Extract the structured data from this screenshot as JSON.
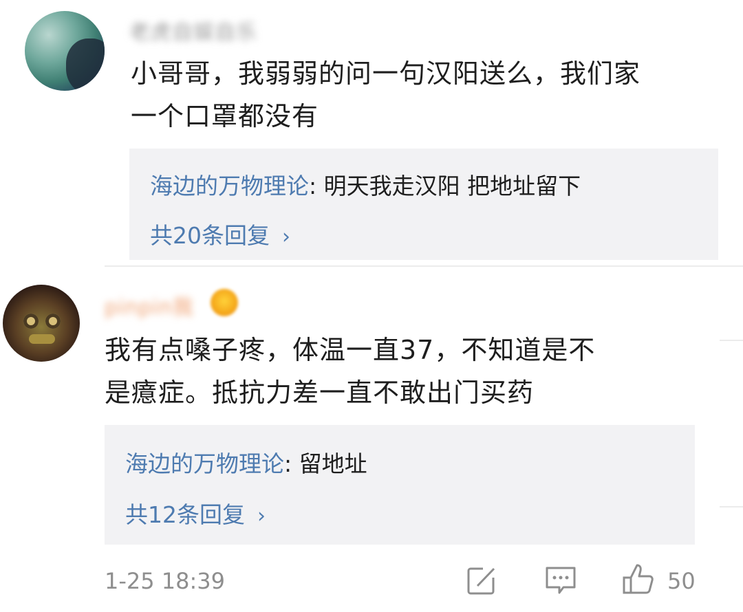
{
  "comments": [
    {
      "username": "老虎自娱自乐",
      "text": "小哥哥，我弱弱的问一句汉阳送么，我们家\n一个口罩都没有",
      "reply": {
        "author": "海边的万物理论",
        "separator": ": ",
        "text": "明天我走汉阳 把地址留下",
        "count_label": "共20条回复"
      }
    },
    {
      "username": "pinpin我",
      "badge": "vip-crown-icon",
      "text": "我有点嗓子疼，体温一直37，不知道是不\n是癔症。抵抗力差一直不敢出门买药",
      "reply": {
        "author": "海边的万物理论",
        "separator": ": ",
        "text": "留地址",
        "count_label": "共12条回复"
      },
      "timestamp": "1-25 18:39",
      "likes": "50"
    }
  ],
  "icons": {
    "chevron": "›",
    "repost": "repost-icon",
    "comment": "comment-icon",
    "like": "like-icon"
  },
  "colors": {
    "link": "#4e7bb0",
    "meta": "#8e8e8e",
    "reply_bg": "#f2f2f4"
  }
}
